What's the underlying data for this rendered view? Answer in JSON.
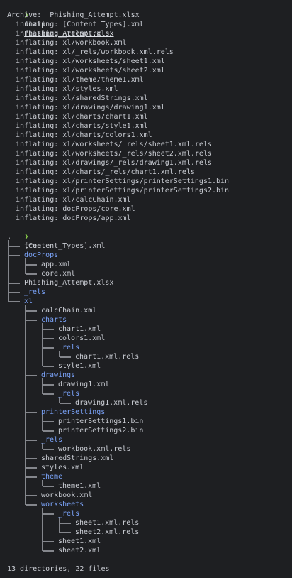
{
  "prompt_symbol": "❯",
  "commands": {
    "unzip": {
      "name": "unzip",
      "argument": "Phishing_Attempt.xlsx"
    },
    "tree": {
      "name": "tree"
    }
  },
  "unzip_output": {
    "archive_line": "Archive:  Phishing_Attempt.xlsx",
    "lines": [
      "  inflating: [Content_Types].xml",
      "  inflating: _rels/.rels",
      "  inflating: xl/workbook.xml",
      "  inflating: xl/_rels/workbook.xml.rels",
      "  inflating: xl/worksheets/sheet1.xml",
      "  inflating: xl/worksheets/sheet2.xml",
      "  inflating: xl/theme/theme1.xml",
      "  inflating: xl/styles.xml",
      "  inflating: xl/sharedStrings.xml",
      "  inflating: xl/drawings/drawing1.xml",
      "  inflating: xl/charts/chart1.xml",
      "  inflating: xl/charts/style1.xml",
      "  inflating: xl/charts/colors1.xml",
      "  inflating: xl/worksheets/_rels/sheet1.xml.rels",
      "  inflating: xl/worksheets/_rels/sheet2.xml.rels",
      "  inflating: xl/drawings/_rels/drawing1.xml.rels",
      "  inflating: xl/charts/_rels/chart1.xml.rels",
      "  inflating: xl/printerSettings/printerSettings1.bin",
      "  inflating: xl/printerSettings/printerSettings2.bin",
      "  inflating: xl/calcChain.xml",
      "  inflating: docProps/core.xml",
      "  inflating: docProps/app.xml"
    ]
  },
  "tree_root": ".",
  "tree": [
    {
      "name": "[Content_Types].xml",
      "type": "file",
      "depth": 1
    },
    {
      "name": "docProps",
      "type": "dir",
      "depth": 1
    },
    {
      "name": "app.xml",
      "type": "file",
      "depth": 2
    },
    {
      "name": "core.xml",
      "type": "file",
      "depth": 2
    },
    {
      "name": "Phishing_Attempt.xlsx",
      "type": "file",
      "depth": 1
    },
    {
      "name": "_rels",
      "type": "dir",
      "depth": 1
    },
    {
      "name": "xl",
      "type": "dir",
      "depth": 1
    },
    {
      "name": "calcChain.xml",
      "type": "file",
      "depth": 2
    },
    {
      "name": "charts",
      "type": "dir",
      "depth": 2
    },
    {
      "name": "chart1.xml",
      "type": "file",
      "depth": 3
    },
    {
      "name": "colors1.xml",
      "type": "file",
      "depth": 3
    },
    {
      "name": "_rels",
      "type": "dir",
      "depth": 3
    },
    {
      "name": "chart1.xml.rels",
      "type": "file",
      "depth": 4
    },
    {
      "name": "style1.xml",
      "type": "file",
      "depth": 3
    },
    {
      "name": "drawings",
      "type": "dir",
      "depth": 2
    },
    {
      "name": "drawing1.xml",
      "type": "file",
      "depth": 3
    },
    {
      "name": "_rels",
      "type": "dir",
      "depth": 3
    },
    {
      "name": "drawing1.xml.rels",
      "type": "file",
      "depth": 4
    },
    {
      "name": "printerSettings",
      "type": "dir",
      "depth": 2
    },
    {
      "name": "printerSettings1.bin",
      "type": "file",
      "depth": 3
    },
    {
      "name": "printerSettings2.bin",
      "type": "file",
      "depth": 3
    },
    {
      "name": "_rels",
      "type": "dir",
      "depth": 2
    },
    {
      "name": "workbook.xml.rels",
      "type": "file",
      "depth": 3
    },
    {
      "name": "sharedStrings.xml",
      "type": "file",
      "depth": 2
    },
    {
      "name": "styles.xml",
      "type": "file",
      "depth": 2
    },
    {
      "name": "theme",
      "type": "dir",
      "depth": 2
    },
    {
      "name": "theme1.xml",
      "type": "file",
      "depth": 3
    },
    {
      "name": "workbook.xml",
      "type": "file",
      "depth": 2
    },
    {
      "name": "worksheets",
      "type": "dir",
      "depth": 2
    },
    {
      "name": "_rels",
      "type": "dir",
      "depth": 3
    },
    {
      "name": "sheet1.xml.rels",
      "type": "file",
      "depth": 4
    },
    {
      "name": "sheet2.xml.rels",
      "type": "file",
      "depth": 4
    },
    {
      "name": "sheet1.xml",
      "type": "file",
      "depth": 3
    },
    {
      "name": "sheet2.xml",
      "type": "file",
      "depth": 3
    }
  ],
  "tree_summary": "13 directories, 22 files",
  "colors": {
    "background": "#1e1f22",
    "prompt": "#8bd14c",
    "directory": "#7aa2f7",
    "text": "#c9ccd3"
  }
}
